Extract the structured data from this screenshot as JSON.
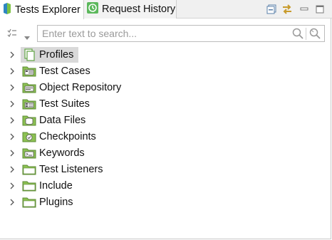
{
  "tabs": {
    "active": {
      "label": "Tests Explorer"
    },
    "inactive": {
      "label": "Request History"
    }
  },
  "search": {
    "placeholder": "Enter text to search..."
  },
  "tree": {
    "items": [
      {
        "label": "Profiles",
        "icon": "profile-icon",
        "selected": true
      },
      {
        "label": "Test Cases",
        "icon": "test-cases-folder-icon"
      },
      {
        "label": "Object Repository",
        "icon": "object-repository-folder-icon"
      },
      {
        "label": "Test Suites",
        "icon": "test-suites-folder-icon"
      },
      {
        "label": "Data Files",
        "icon": "data-files-folder-icon"
      },
      {
        "label": "Checkpoints",
        "icon": "checkpoints-folder-icon"
      },
      {
        "label": "Keywords",
        "icon": "keywords-folder-icon"
      },
      {
        "label": "Test Listeners",
        "icon": "folder-icon"
      },
      {
        "label": "Include",
        "icon": "folder-icon"
      },
      {
        "label": "Plugins",
        "icon": "folder-icon"
      }
    ]
  },
  "colors": {
    "accent_green": "#6aa84f",
    "folder_green": "#8cc152",
    "selection": "#d9d9d9",
    "tab_bg": "#f0f0f0"
  }
}
